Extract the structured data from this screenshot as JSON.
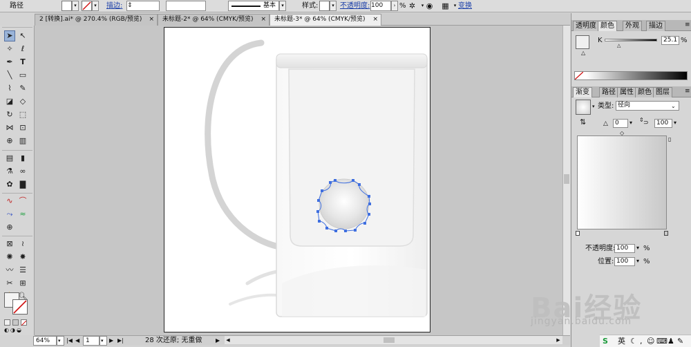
{
  "controlbar": {
    "object_type": "路径",
    "stroke_label": "描边:",
    "stroke_weight_value": "",
    "stroke_profile": "基本",
    "style_label": "样式:",
    "opacity_label": "不透明度:",
    "opacity_value": "100",
    "opacity_unit": "%",
    "transform_label": "变换"
  },
  "tabs": [
    {
      "label": "2 [转换].ai* @ 270.4% (RGB/预览)",
      "active": false
    },
    {
      "label": "未标题-2* @ 64% (CMYK/预览)",
      "active": false
    },
    {
      "label": "未标题-3* @ 64% (CMYK/预览)",
      "active": true
    }
  ],
  "tab_close_glyph": "×",
  "statusbar": {
    "zoom": "64%",
    "artboard_number": "1",
    "status_text": "28 次还原; 无重做"
  },
  "color_panel": {
    "tabs": [
      "透明度",
      "颜色",
      "外观",
      "描边"
    ],
    "active_tab": "颜色",
    "channel_label": "K",
    "channel_value": "25.1",
    "unit": "%"
  },
  "gradient_panel": {
    "tabs": [
      "渐变",
      "路径",
      "属性",
      "颜色",
      "图层"
    ],
    "active_tab": "渐变",
    "type_label": "类型:",
    "type_value": "径向",
    "angle_value": "0",
    "aspect_value": "100",
    "opacity_label": "不透明度:",
    "opacity_value": "100",
    "location_label": "位置:",
    "location_value": "100",
    "unit": "%"
  },
  "watermark": {
    "brand": "Bai经验",
    "url": "jingyan.baidu.com"
  },
  "tray": {
    "ime_label": "英"
  },
  "colors": {
    "ui_gray": "#d6d6d6",
    "link_blue": "#1a3ea8",
    "selection_blue": "#3f6fe0",
    "k_value_gray": "#bfbfbf"
  }
}
